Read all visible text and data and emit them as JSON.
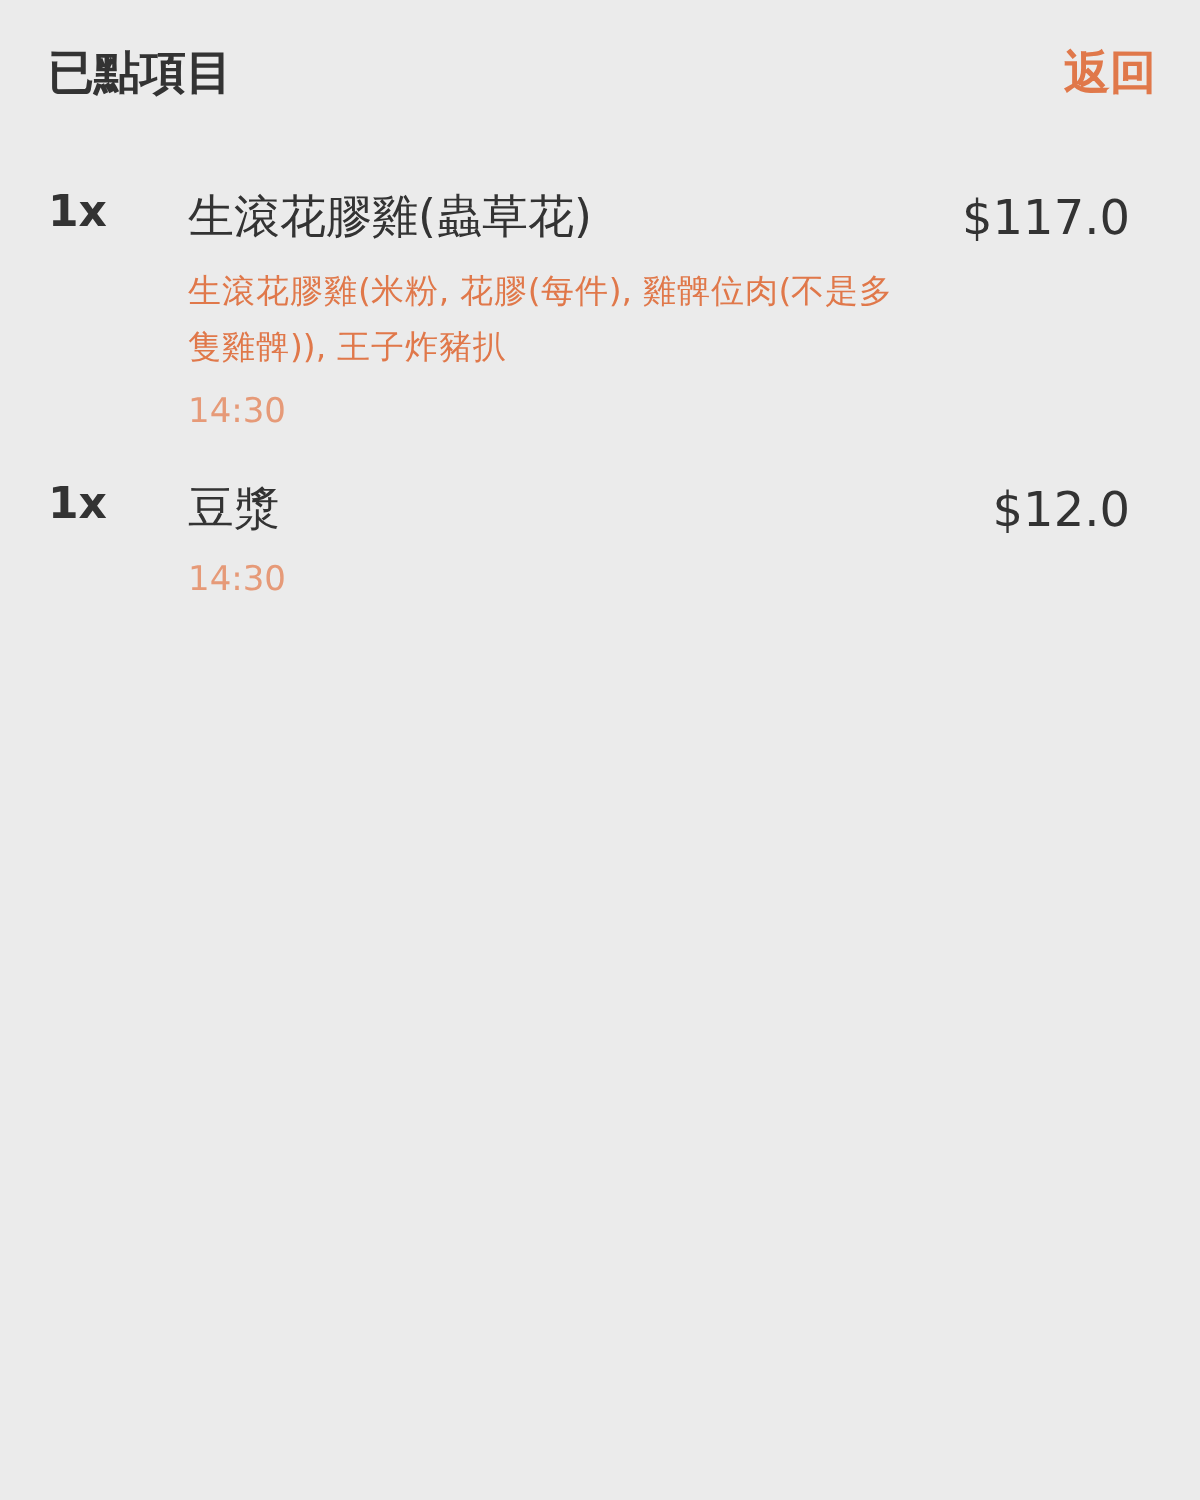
{
  "header": {
    "title": "已點項目",
    "back": "返回"
  },
  "items": [
    {
      "quantity": "1x",
      "name": "生滾花膠雞(蟲草花)",
      "price": "$117.0",
      "options": "生滾花膠雞(米粉, 花膠(每件), 雞髀位肉(不是多隻雞髀)), 王子炸豬扒",
      "time": "14:30"
    },
    {
      "quantity": "1x",
      "name": "豆漿",
      "price": "$12.0",
      "time": "14:30"
    }
  ]
}
